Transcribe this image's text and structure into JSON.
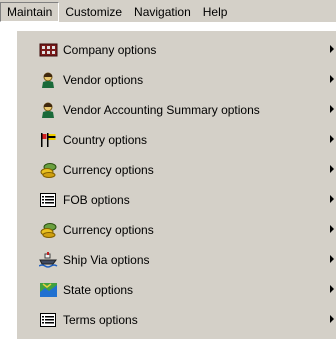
{
  "menubar": {
    "items": [
      {
        "label": "Maintain"
      },
      {
        "label": "Customize"
      },
      {
        "label": "Navigation"
      },
      {
        "label": "Help"
      }
    ]
  },
  "dropdown": {
    "items": [
      {
        "label": "Company options",
        "icon": "company-icon"
      },
      {
        "label": "Vendor options",
        "icon": "vendor-icon"
      },
      {
        "label": "Vendor Accounting Summary options",
        "icon": "vendor-icon"
      },
      {
        "label": "Country options",
        "icon": "country-flags-icon"
      },
      {
        "label": "Currency options",
        "icon": "currency-coins-icon"
      },
      {
        "label": "FOB options",
        "icon": "list-box-icon"
      },
      {
        "label": "Currency options",
        "icon": "currency-coins-icon"
      },
      {
        "label": "Ship Via options",
        "icon": "ship-icon"
      },
      {
        "label": "State options",
        "icon": "map-icon"
      },
      {
        "label": "Terms options",
        "icon": "list-box-icon"
      }
    ]
  },
  "colors": {
    "menu_background": "#d4d0c8",
    "text": "#000000"
  }
}
